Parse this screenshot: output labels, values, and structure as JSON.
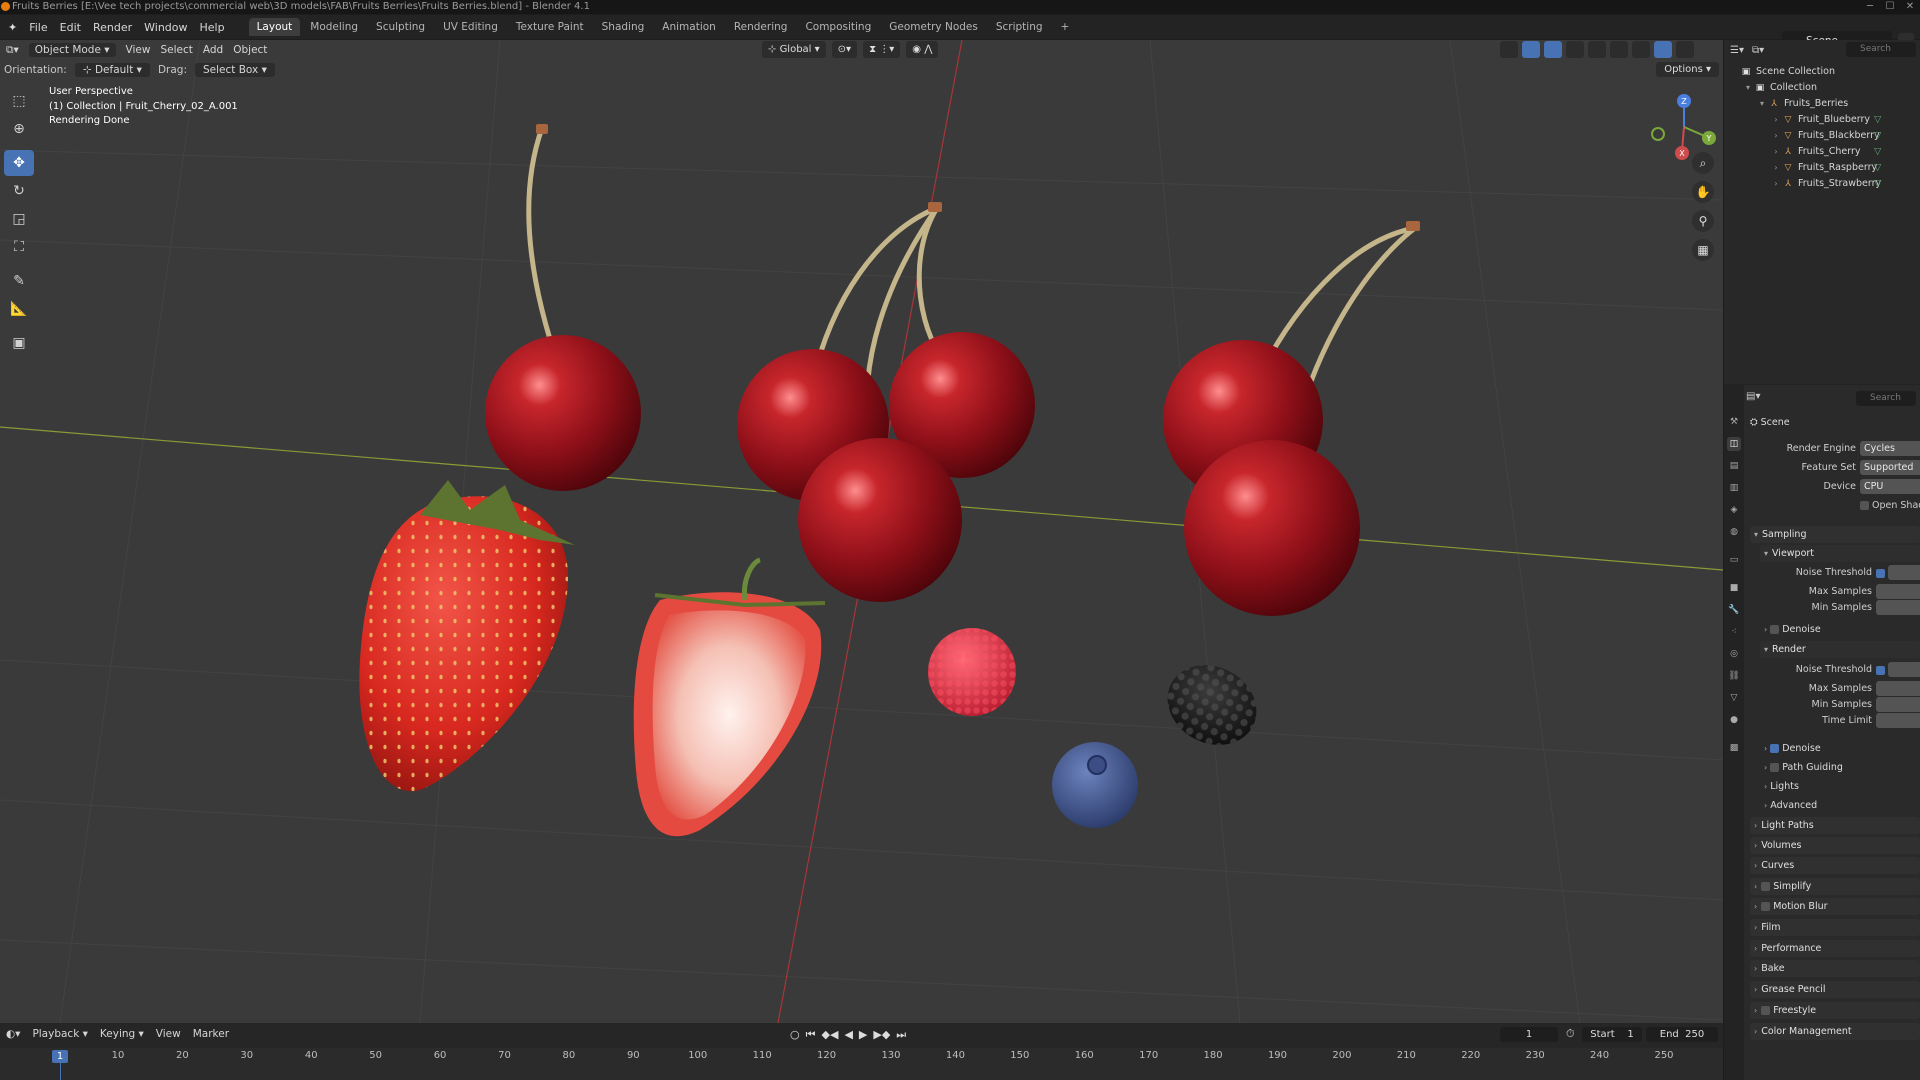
{
  "window": {
    "title": "Fruits Berries [E:\\Vee tech projects\\commercial web\\3D models\\FAB\\Fruits Berries\\Fruits Berries.blend] - Blender 4.1"
  },
  "menu": [
    "File",
    "Edit",
    "Render",
    "Window",
    "Help"
  ],
  "workspaces": [
    "Layout",
    "Modeling",
    "Sculpting",
    "UV Editing",
    "Texture Paint",
    "Shading",
    "Animation",
    "Rendering",
    "Compositing",
    "Geometry Nodes",
    "Scripting",
    "+"
  ],
  "scene_selector": "Scene",
  "viewport": {
    "header": {
      "mode": "Object Mode",
      "menus": [
        "View",
        "Select",
        "Add",
        "Object"
      ],
      "transform": "Global"
    },
    "header2": {
      "orientation_label": "Orientation:",
      "orientation": "Default",
      "drag_label": "Drag:",
      "drag": "Select Box",
      "options": "Options"
    },
    "overlay": [
      "User Perspective",
      "(1) Collection | Fruit_Cherry_02_A.001",
      "Rendering Done"
    ],
    "gizmo": {
      "z": "Z",
      "y": "Y",
      "x": "X"
    }
  },
  "outliner": {
    "search": "Search",
    "rows": [
      {
        "label": "Scene Collection",
        "level": 0,
        "icon": "collection"
      },
      {
        "label": "Collection",
        "level": 1,
        "icon": "collection"
      },
      {
        "label": "Fruits_Berries",
        "level": 2,
        "icon": "empty"
      },
      {
        "label": "Fruit_Blueberry",
        "level": 3,
        "icon": "mesh"
      },
      {
        "label": "Fruits_Blackberry",
        "level": 3,
        "icon": "mesh"
      },
      {
        "label": "Fruits_Cherry",
        "level": 3,
        "icon": "empty"
      },
      {
        "label": "Fruits_Raspberry",
        "level": 3,
        "icon": "mesh"
      },
      {
        "label": "Fruits_Strawberry",
        "level": 3,
        "icon": "empty"
      }
    ]
  },
  "properties": {
    "search": "Search",
    "context": "Scene",
    "render_engine": {
      "label": "Render Engine",
      "value": "Cycles"
    },
    "feature_set": {
      "label": "Feature Set",
      "value": "Supported"
    },
    "device": {
      "label": "Device",
      "value": "CPU"
    },
    "osl_label": "Open Shading Language",
    "sections": {
      "sampling": "Sampling",
      "viewport": "Viewport",
      "noise_threshold": "Noise Threshold",
      "max_samples": "Max Samples",
      "min_samples": "Min Samples",
      "denoise": "Denoise",
      "render": "Render",
      "time_limit": "Time Limit",
      "path_guiding": "Path Guiding",
      "lights": "Lights",
      "advanced": "Advanced",
      "light_paths": "Light Paths",
      "volumes": "Volumes",
      "curves": "Curves",
      "simplify": "Simplify",
      "motion_blur": "Motion Blur",
      "film": "Film",
      "performance": "Performance",
      "bake": "Bake",
      "grease_pencil": "Grease Pencil",
      "freestyle": "Freestyle",
      "color_management": "Color Management"
    }
  },
  "timeline": {
    "menus": [
      "Playback",
      "Keying",
      "View",
      "Marker"
    ],
    "current_frame": "1",
    "start_label": "Start",
    "start": "1",
    "end_label": "End",
    "end": "250",
    "ticks": [
      "1",
      "10",
      "20",
      "30",
      "40",
      "50",
      "60",
      "70",
      "80",
      "90",
      "100",
      "110",
      "120",
      "130",
      "140",
      "150",
      "160",
      "170",
      "180",
      "190",
      "200",
      "210",
      "220",
      "230",
      "240",
      "250"
    ]
  },
  "colors": {
    "accent": "#4772b3",
    "viewport_bg": "#3a3a3a",
    "panel_bg": "#2a2a2a",
    "orange": "#e87d0d"
  }
}
